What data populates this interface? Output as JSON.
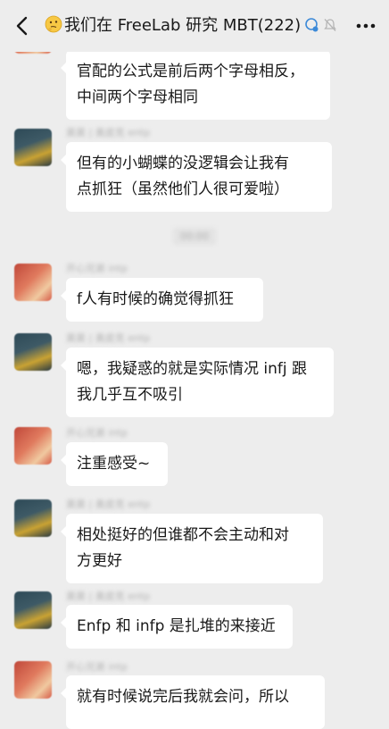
{
  "header": {
    "title": "我们在 FreeLab 研究 MBT",
    "member_count": "(222)"
  },
  "timestamp": "00:00",
  "messages": [
    {
      "sender": "",
      "lines": [
        "官配的公式是前后两个字母相反，",
        "中间两个字母相同"
      ]
    },
    {
      "sender": "昊昊 | 奥皮克 entp",
      "lines": [
        "但有的小蝴蝶的没逻辑会让我有",
        "点抓狂（虽然他们人很可爱啦）"
      ]
    },
    {
      "sender": "开心兄弟 intp",
      "lines": [
        "f人有时候的确觉得抓狂"
      ]
    },
    {
      "sender": "昊昊 | 奥皮克 entp",
      "lines": [
        "嗯，我疑惑的就是实际情况 infj 跟",
        "我几乎互不吸引"
      ]
    },
    {
      "sender": "开心兄弟 intp",
      "lines": [
        "注重感受~"
      ]
    },
    {
      "sender": "昊昊 | 奥皮克 entp",
      "lines": [
        "相处挺好的但谁都不会主动和对",
        "方更好"
      ]
    },
    {
      "sender": "昊昊 | 奥皮克 entp",
      "lines": [
        "Enfp 和 infp 是扎堆的来接近"
      ]
    },
    {
      "sender": "开心兄弟 intp",
      "lines": [
        "就有时候说完后我就会问，所以"
      ]
    }
  ]
}
